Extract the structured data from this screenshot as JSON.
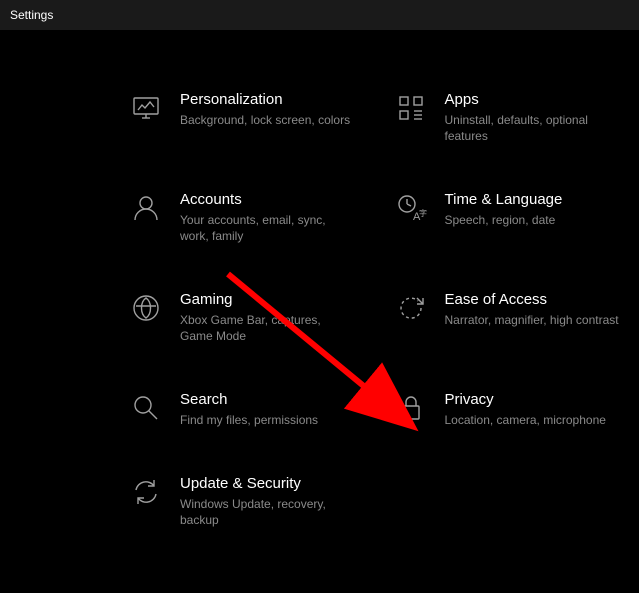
{
  "window": {
    "title": "Settings"
  },
  "tiles": [
    {
      "title": "Personalization",
      "desc": "Background, lock screen, colors"
    },
    {
      "title": "Apps",
      "desc": "Uninstall, defaults, optional features"
    },
    {
      "title": "Accounts",
      "desc": "Your accounts, email, sync, work, family"
    },
    {
      "title": "Time & Language",
      "desc": "Speech, region, date"
    },
    {
      "title": "Gaming",
      "desc": "Xbox Game Bar, captures, Game Mode"
    },
    {
      "title": "Ease of Access",
      "desc": "Narrator, magnifier, high contrast"
    },
    {
      "title": "Search",
      "desc": "Find my files, permissions"
    },
    {
      "title": "Privacy",
      "desc": "Location, camera, microphone"
    },
    {
      "title": "Update & Security",
      "desc": "Windows Update, recovery, backup"
    }
  ]
}
